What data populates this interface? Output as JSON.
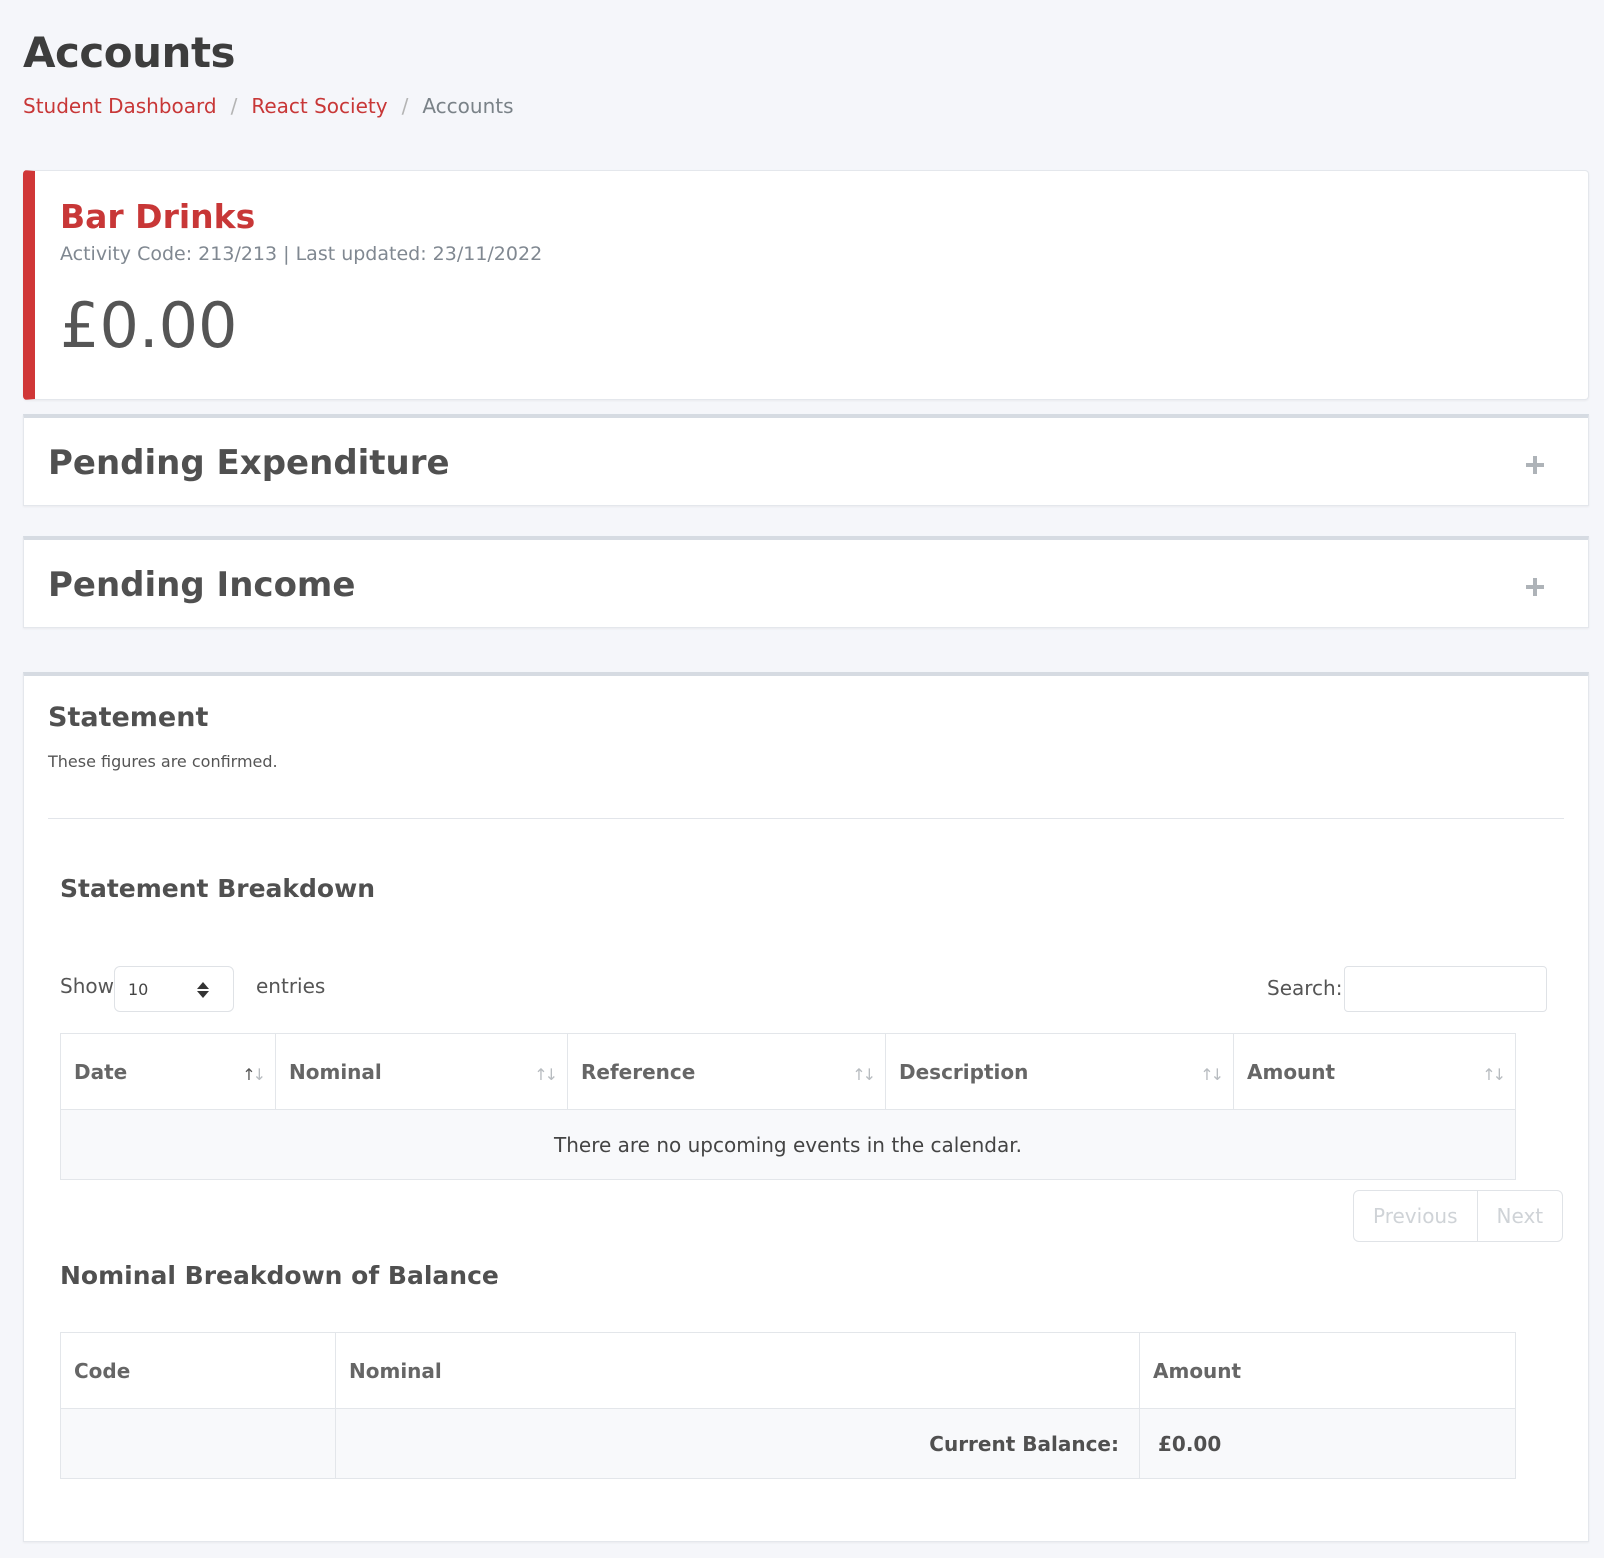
{
  "page": {
    "title": "Accounts",
    "breadcrumb": [
      "Student Dashboard",
      "React Society",
      "Accounts"
    ]
  },
  "account": {
    "name": "Bar Drinks",
    "meta": "Activity Code: 213/213 | Last updated: 23/11/2022",
    "balance": "£0.00"
  },
  "pending_expenditure": {
    "title": "Pending Expenditure"
  },
  "pending_income": {
    "title": "Pending Income"
  },
  "statement": {
    "title": "Statement",
    "note": "These figures are confirmed.",
    "breakdown_title": "Statement Breakdown",
    "show_label": "Show",
    "entries_value": "10",
    "entries_label": "entries",
    "search_label": "Search:",
    "search_value": "",
    "columns": [
      "Date",
      "Nominal",
      "Reference",
      "Description",
      "Amount"
    ],
    "empty_message": "There are no upcoming events in the calendar.",
    "previous_label": "Previous",
    "next_label": "Next"
  },
  "nominal": {
    "title": "Nominal Breakdown of Balance",
    "columns": [
      "Code",
      "Nominal",
      "Amount"
    ],
    "balance_label": "Current Balance:",
    "balance_value": "£0.00"
  },
  "colors": {
    "accent": "#c83737",
    "background": "#f5f6fa"
  }
}
